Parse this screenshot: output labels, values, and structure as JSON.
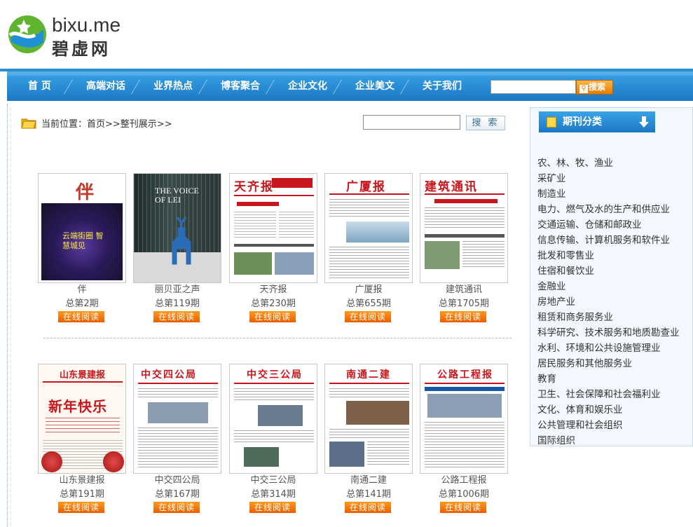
{
  "logo": {
    "en": "bixu.me",
    "cn": "碧虚网"
  },
  "nav": {
    "items": [
      "首 页",
      "高端对话",
      "业界热点",
      "博客聚合",
      "企业文化",
      "企业美文",
      "关于我们"
    ],
    "search_button": "搜索"
  },
  "breadcrumb": {
    "prefix": "当前位置：",
    "path": "首页>>整刊展示>>"
  },
  "page_search": {
    "button": "搜 索"
  },
  "read_label": "在线阅读",
  "row1": [
    {
      "name": "伴",
      "issue": "总第2期",
      "cover_text": "伴BANER",
      "cover_sub": "云端街圈 智慧城见"
    },
    {
      "name": "丽贝亚之声",
      "issue": "总第119期",
      "cover_text": "THE VOICE OF LEI"
    },
    {
      "name": "天齐报",
      "issue": "总第230期",
      "cover_text": "天齐报"
    },
    {
      "name": "广厦报",
      "issue": "总第655期",
      "cover_text": "广厦报"
    },
    {
      "name": "建筑通讯",
      "issue": "总第1705期",
      "cover_text": "建筑通讯"
    }
  ],
  "row2": [
    {
      "name": "山东景建报",
      "issue": "总第191期",
      "cover_text": "山东景建报",
      "cover_sub": "新年快乐"
    },
    {
      "name": "中交四公局",
      "issue": "总第167期",
      "cover_text": "中交四公局"
    },
    {
      "name": "中交三公局",
      "issue": "总第314期",
      "cover_text": "中交三公局"
    },
    {
      "name": "南通二建",
      "issue": "总第141期",
      "cover_text": "南通二建"
    },
    {
      "name": "公路工程报",
      "issue": "总第1006期",
      "cover_text": "公路工程报"
    }
  ],
  "sidebar": {
    "title": "期刊分类",
    "items": [
      "农、林、牧、渔业",
      "采矿业",
      "制造业",
      "电力、燃气及水的生产和供应业",
      "交通运输、仓储和邮政业",
      "信息传输、计算机服务和软件业",
      "批发和零售业",
      "住宿和餐饮业",
      "金融业",
      "房地产业",
      "租赁和商务服务业",
      "科学研究、技术服务和地质勘查业",
      "水利、环境和公共设施管理业",
      "居民服务和其他服务业",
      "教育",
      "卫生、社会保障和社会福利业",
      "文化、体育和娱乐业",
      "公共管理和社会组织",
      "国际组织"
    ]
  },
  "colors": {
    "nav_blue": "#1b78c4",
    "accent_orange": "#e95f00",
    "masthead_red": "#c8161d"
  }
}
